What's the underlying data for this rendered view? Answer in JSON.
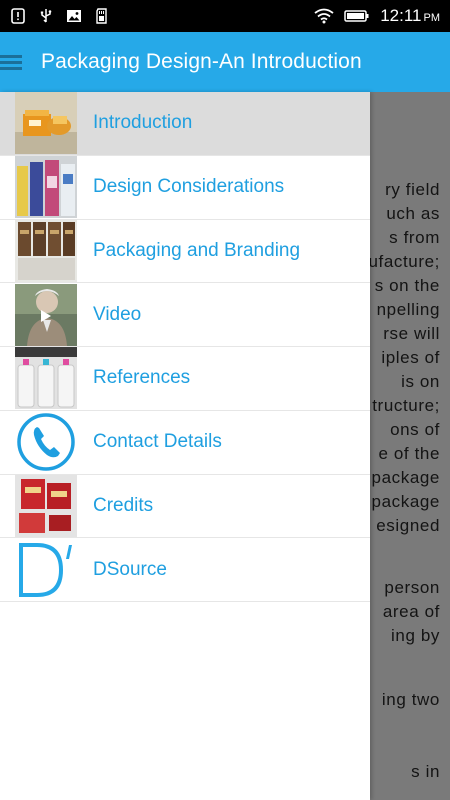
{
  "status_bar": {
    "time": "12:11",
    "ampm": "PM",
    "icons": [
      "notification-alert-icon",
      "usb-icon",
      "image-icon",
      "sd-card-icon",
      "wifi-icon",
      "battery-icon"
    ]
  },
  "app_bar": {
    "title": "Packaging Design-An Introduction",
    "color": "#26a9e8"
  },
  "drawer": {
    "items": [
      {
        "label": "Introduction",
        "active": true,
        "thumb": "packaging-products-thumbnail"
      },
      {
        "label": "Design Considerations",
        "active": false,
        "thumb": "bottles-thumbnail"
      },
      {
        "label": "Packaging and Branding",
        "active": false,
        "thumb": "tins-thumbnail"
      },
      {
        "label": "Video",
        "active": false,
        "thumb": "video-thumbnail"
      },
      {
        "label": "References",
        "active": false,
        "thumb": "plastic-bottles-thumbnail"
      },
      {
        "label": "Contact Details",
        "active": false,
        "thumb": "phone-icon"
      },
      {
        "label": "Credits",
        "active": false,
        "thumb": "credits-thumbnail"
      },
      {
        "label": "DSource",
        "active": false,
        "thumb": "dsource-logo"
      }
    ],
    "label_color": "#1f9fe0"
  },
  "background_text": {
    "lines": [
      "ry field",
      "uch as",
      "s from",
      "ufacture;",
      "s on the",
      "npelling",
      "rse will",
      "iples of",
      "is on",
      "tructure;",
      "ons of",
      "e of the",
      "package",
      "package",
      "esigned",
      "person",
      "area of",
      "ing by",
      "ing two",
      "s in"
    ]
  }
}
